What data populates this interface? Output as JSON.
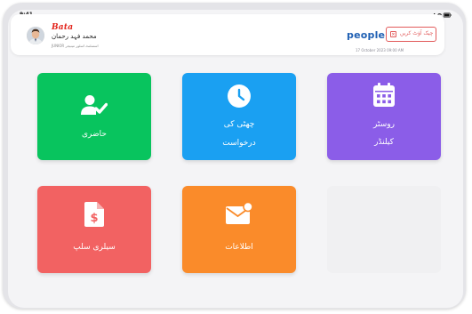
{
  "status_bar": {
    "time": "9:41"
  },
  "header": {
    "brand": "Bata",
    "user_name": "محمد فہد رحمان",
    "user_subtitle": "JUNIOR اسسٹنٹ اسٹور مینیجر",
    "company_logo": "people",
    "checkout_label": "چیک آؤٹ کریں",
    "datetime": "17 October 2023  09:00 AM"
  },
  "tiles": {
    "attendance": {
      "label": "حاضری",
      "icon": "user-check-icon",
      "color": "#08c45e"
    },
    "leave": {
      "label_line1": "چھٹی کی",
      "label_line2": "درخواست",
      "icon": "clock-icon",
      "color": "#1aa0f2"
    },
    "roster": {
      "label_line1": "روسٹر",
      "label_line2": "کیلنڈر",
      "icon": "calendar-icon",
      "color": "#8b5de8"
    },
    "salary": {
      "label": "سیلری سلپ",
      "icon": "dollar-document-icon",
      "color": "#f26262"
    },
    "notifications": {
      "label": "اطلاعات",
      "icon": "mail-notification-icon",
      "color": "#fa8b2a"
    }
  }
}
